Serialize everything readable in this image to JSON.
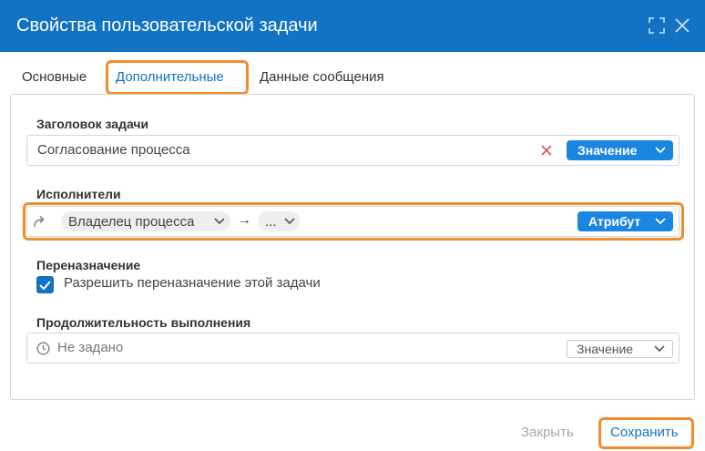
{
  "dialog": {
    "title": "Свойства пользовательской задачи"
  },
  "tabs": [
    {
      "label": "Основные"
    },
    {
      "label": "Дополнительные"
    },
    {
      "label": "Данные сообщения"
    }
  ],
  "task_title": {
    "label": "Заголовок задачи",
    "value": "Согласование процесса",
    "mode": "Значение"
  },
  "executors": {
    "label": "Исполнители",
    "source": "Владелец процесса",
    "arrow": "→",
    "next": "...",
    "mode": "Атрибут"
  },
  "reassign": {
    "label": "Переназначение",
    "checkbox_label": "Разрешить переназначение этой задачи",
    "checked": true
  },
  "duration": {
    "label": "Продолжительность выполнения",
    "value": "Не задано",
    "mode": "Значение"
  },
  "footer": {
    "close_label": "Закрыть",
    "save_label": "Сохранить"
  },
  "colors": {
    "header": "#1272c4",
    "accent": "#1a86e0",
    "highlight": "#f08c2c",
    "clear": "#d9534f"
  }
}
